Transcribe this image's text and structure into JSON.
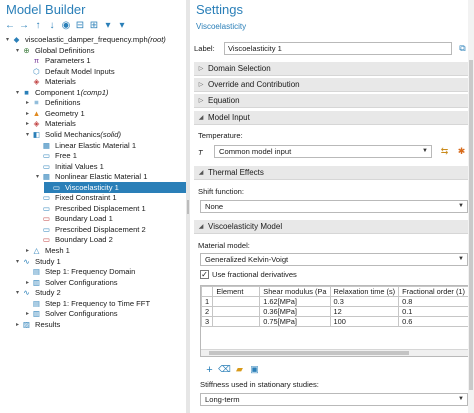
{
  "model_builder": {
    "title": "Model Builder",
    "tree": [
      {
        "label": "viscoelastic_damper_frequency.mph",
        "suffix": " (root)",
        "level": 0,
        "toggle": "▾",
        "icon": "root-icon",
        "color": "#2a7fb8"
      },
      {
        "label": "Global Definitions",
        "level": 1,
        "toggle": "▾",
        "icon": "globe-icon",
        "color": "#3a7a3a"
      },
      {
        "label": "Parameters 1",
        "level": 2,
        "toggle": "",
        "icon": "parameters-icon",
        "color": "#7a3a9a"
      },
      {
        "label": "Default Model Inputs",
        "level": 2,
        "toggle": "",
        "icon": "model-inputs-icon",
        "color": "#2a7fb8"
      },
      {
        "label": "Materials",
        "level": 2,
        "toggle": "",
        "icon": "materials-icon",
        "color": "#c04040"
      },
      {
        "label": "Component 1",
        "suffix": " (comp1)",
        "level": 1,
        "toggle": "▾",
        "icon": "component-icon",
        "color": "#2a7fb8"
      },
      {
        "label": "Definitions",
        "level": 2,
        "toggle": "▸",
        "icon": "definitions-icon",
        "color": "#2a7fb8"
      },
      {
        "label": "Geometry 1",
        "level": 2,
        "toggle": "▸",
        "icon": "geometry-icon",
        "color": "#e08a20"
      },
      {
        "label": "Materials",
        "level": 2,
        "toggle": "▸",
        "icon": "materials-icon",
        "color": "#c04040"
      },
      {
        "label": "Solid Mechanics",
        "suffix": " (solid)",
        "level": 2,
        "toggle": "▾",
        "icon": "solid-mechanics-icon",
        "color": "#2a7fb8"
      },
      {
        "label": "Linear Elastic Material 1",
        "level": 3,
        "toggle": "",
        "icon": "material-model-icon",
        "color": "#2a7fb8"
      },
      {
        "label": "Free 1",
        "level": 3,
        "toggle": "",
        "icon": "free-icon",
        "color": "#2a7fb8"
      },
      {
        "label": "Initial Values 1",
        "level": 3,
        "toggle": "",
        "icon": "initial-values-icon",
        "color": "#2a7fb8"
      },
      {
        "label": "Nonlinear Elastic Material 1",
        "level": 3,
        "toggle": "▾",
        "icon": "material-model-icon",
        "color": "#2a7fb8"
      },
      {
        "label": "Viscoelasticity 1",
        "level": 4,
        "toggle": "",
        "icon": "viscoelasticity-icon",
        "color": "#ffffff",
        "selected": true
      },
      {
        "label": "Fixed Constraint 1",
        "level": 3,
        "toggle": "",
        "icon": "fixed-constraint-icon",
        "color": "#2a7fb8"
      },
      {
        "label": "Prescribed Displacement 1",
        "level": 3,
        "toggle": "",
        "icon": "displacement-icon",
        "color": "#2a7fb8"
      },
      {
        "label": "Boundary Load 1",
        "level": 3,
        "toggle": "",
        "icon": "boundary-load-icon",
        "color": "#c04040"
      },
      {
        "label": "Prescribed Displacement 2",
        "level": 3,
        "toggle": "",
        "icon": "displacement-icon",
        "color": "#2a7fb8"
      },
      {
        "label": "Boundary Load 2",
        "level": 3,
        "toggle": "",
        "icon": "boundary-load-icon",
        "color": "#c04040"
      },
      {
        "label": "Mesh 1",
        "level": 2,
        "toggle": "▸",
        "icon": "mesh-icon",
        "color": "#2a7fb8"
      },
      {
        "label": "Study 1",
        "level": 1,
        "toggle": "▾",
        "icon": "study-icon",
        "color": "#2a7fb8"
      },
      {
        "label": "Step 1: Frequency Domain",
        "level": 2,
        "toggle": "",
        "icon": "study-step-icon",
        "color": "#2a7fb8"
      },
      {
        "label": "Solver Configurations",
        "level": 2,
        "toggle": "▸",
        "icon": "solver-icon",
        "color": "#2a7fb8"
      },
      {
        "label": "Study 2",
        "level": 1,
        "toggle": "▾",
        "icon": "study-icon",
        "color": "#2a7fb8"
      },
      {
        "label": "Step 1: Frequency to Time FFT",
        "level": 2,
        "toggle": "",
        "icon": "study-step-icon",
        "color": "#2a7fb8"
      },
      {
        "label": "Solver Configurations",
        "level": 2,
        "toggle": "▸",
        "icon": "solver-icon",
        "color": "#2a7fb8"
      },
      {
        "label": "Results",
        "level": 1,
        "toggle": "▸",
        "icon": "results-icon",
        "color": "#2a7fb8"
      }
    ]
  },
  "settings": {
    "title": "Settings",
    "subtitle": "Viscoelasticity",
    "label_caption": "Label:",
    "label_value": "Viscoelasticity 1",
    "sections": {
      "domain_selection": "Domain Selection",
      "override": "Override and Contribution",
      "equation": "Equation",
      "model_input": "Model Input",
      "thermal": "Thermal Effects",
      "visco_model": "Viscoelasticity Model"
    },
    "temperature_caption": "Temperature:",
    "temperature_symbol": "T",
    "temperature_value": "Common model input",
    "shift_caption": "Shift function:",
    "shift_value": "None",
    "material_model_caption": "Material model:",
    "material_model_value": "Generalized Kelvin-Voigt",
    "use_fractional_label": "Use fractional derivatives",
    "use_fractional_checked": true,
    "table": {
      "headers": [
        "",
        "Element",
        "Shear modulus (Pa",
        "Relaxation time (s)",
        "Fractional order (1)"
      ],
      "rows": [
        [
          "1",
          "1.62[MPa]",
          "0.3",
          "0.8"
        ],
        [
          "2",
          "0.36[MPa]",
          "12",
          "0.1"
        ],
        [
          "3",
          "0.75[MPa]",
          "100",
          "0.6"
        ]
      ]
    },
    "stiffness_caption": "Stiffness used in stationary studies:",
    "stiffness_value": "Long-term"
  }
}
